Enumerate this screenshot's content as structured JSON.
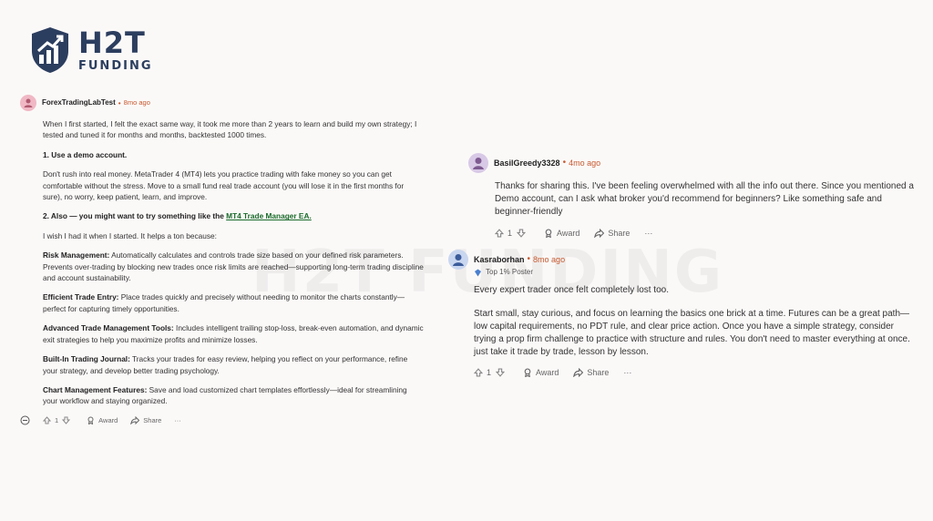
{
  "logo": {
    "main": "H2T",
    "sub": "FUNDING"
  },
  "watermark": "H2T FUNDING",
  "comments": [
    {
      "username": "ForexTradingLabTest",
      "time": "8mo ago",
      "paragraphs": {
        "p1": "When I first started, I felt the exact same way, it took me more than 2 years to learn and build my own strategy; I tested and tuned it for months and months, backtested 1000 times.",
        "h1": "1. Use a demo account.",
        "p2": "Don't rush into real money. MetaTrader 4 (MT4) lets you practice trading with fake money so you can get comfortable without the stress. Move to a small fund real trade account (you will lose it in the first months for sure), no worry, keep patient, learn, and improve.",
        "h2_prefix": "2. Also — you might want to try something like the ",
        "h2_link": "MT4 Trade Manager EA.",
        "p3": "I wish I had it when I started. It helps a ton because:",
        "f1_title": "Risk Management:",
        "f1_text": " Automatically calculates and controls trade size based on your defined risk parameters. Prevents over-trading by blocking new trades once risk limits are reached—supporting long-term trading discipline and account sustainability.",
        "f2_title": "Efficient Trade Entry:",
        "f2_text": " Place trades quickly and precisely without needing to monitor the charts constantly—perfect for capturing timely opportunities.",
        "f3_title": "Advanced Trade Management Tools:",
        "f3_text": " Includes intelligent trailing stop-loss, break-even automation, and dynamic exit strategies to help you maximize profits and minimize losses.",
        "f4_title": "Built-In Trading Journal:",
        "f4_text": " Tracks your trades for easy review, helping you reflect on your performance, refine your strategy, and develop better trading psychology.",
        "f5_title": "Chart Management Features:",
        "f5_text": " Save and load customized chart templates effortlessly—ideal for streamlining your workflow and staying organized."
      },
      "votes": "1",
      "award": "Award",
      "share": "Share",
      "more": "···"
    },
    {
      "username": "BasilGreedy3328",
      "time": "4mo ago",
      "text": "Thanks for sharing this. I've been feeling overwhelmed with all the info out there. Since you mentioned a Demo account, can I ask what broker you'd recommend for beginners? Like something safe and beginner-friendly",
      "votes": "1",
      "award": "Award",
      "share": "Share",
      "more": "···"
    },
    {
      "username": "Kasraborhan",
      "time": "8mo ago",
      "badge": "Top 1% Poster",
      "p1": "Every expert trader once felt completely lost too.",
      "p2": "Start small, stay curious, and focus on learning the basics one brick at a time. Futures can be a great path—low capital requirements, no PDT rule, and clear price action. Once you have a simple strategy, consider trying a prop firm challenge to practice with structure and rules. You don't need to master everything at once. just take it trade by trade, lesson by lesson.",
      "votes": "1",
      "award": "Award",
      "share": "Share",
      "more": "···"
    }
  ],
  "icons": [
    "shield-logo-icon",
    "collapse-icon",
    "upvote-icon",
    "downvote-icon",
    "award-icon",
    "share-icon",
    "more-icon",
    "avatar-icon",
    "badge-icon"
  ],
  "colors": {
    "brand": "#2c3e5f",
    "timestamp": "#c85a30",
    "link": "#1a6b2b",
    "background": "#fbf9f8"
  }
}
